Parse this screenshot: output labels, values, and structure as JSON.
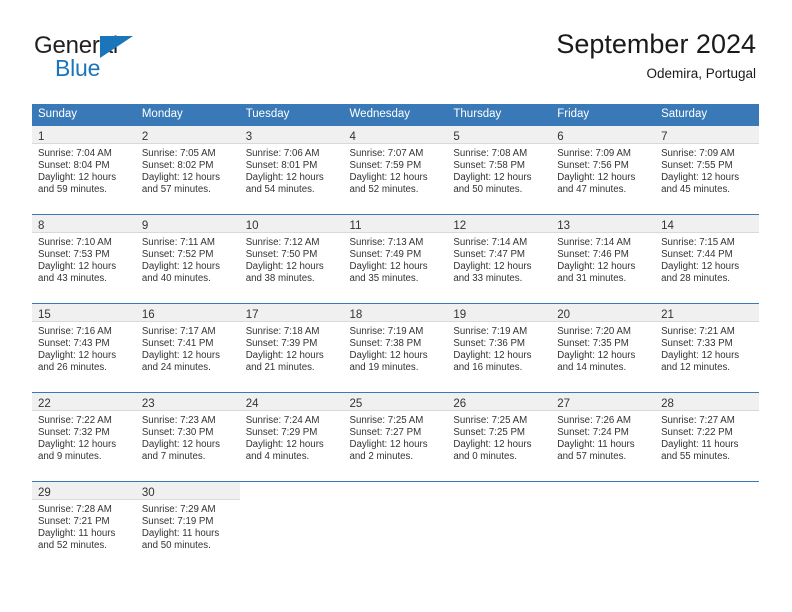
{
  "brand": {
    "name_part1": "General",
    "name_part2": "Blue",
    "accent_color": "#1b75bb"
  },
  "header": {
    "title": "September 2024",
    "subtitle": "Odemira, Portugal"
  },
  "theme": {
    "header_row_color": "#3a79b8",
    "daynum_band_color": "#f0f0f0",
    "text_color": "#333333"
  },
  "weekdays": [
    "Sunday",
    "Monday",
    "Tuesday",
    "Wednesday",
    "Thursday",
    "Friday",
    "Saturday"
  ],
  "weeks": [
    [
      {
        "day": "1",
        "lines": [
          "Sunrise: 7:04 AM",
          "Sunset: 8:04 PM",
          "Daylight: 12 hours",
          "and 59 minutes."
        ]
      },
      {
        "day": "2",
        "lines": [
          "Sunrise: 7:05 AM",
          "Sunset: 8:02 PM",
          "Daylight: 12 hours",
          "and 57 minutes."
        ]
      },
      {
        "day": "3",
        "lines": [
          "Sunrise: 7:06 AM",
          "Sunset: 8:01 PM",
          "Daylight: 12 hours",
          "and 54 minutes."
        ]
      },
      {
        "day": "4",
        "lines": [
          "Sunrise: 7:07 AM",
          "Sunset: 7:59 PM",
          "Daylight: 12 hours",
          "and 52 minutes."
        ]
      },
      {
        "day": "5",
        "lines": [
          "Sunrise: 7:08 AM",
          "Sunset: 7:58 PM",
          "Daylight: 12 hours",
          "and 50 minutes."
        ]
      },
      {
        "day": "6",
        "lines": [
          "Sunrise: 7:09 AM",
          "Sunset: 7:56 PM",
          "Daylight: 12 hours",
          "and 47 minutes."
        ]
      },
      {
        "day": "7",
        "lines": [
          "Sunrise: 7:09 AM",
          "Sunset: 7:55 PM",
          "Daylight: 12 hours",
          "and 45 minutes."
        ]
      }
    ],
    [
      {
        "day": "8",
        "lines": [
          "Sunrise: 7:10 AM",
          "Sunset: 7:53 PM",
          "Daylight: 12 hours",
          "and 43 minutes."
        ]
      },
      {
        "day": "9",
        "lines": [
          "Sunrise: 7:11 AM",
          "Sunset: 7:52 PM",
          "Daylight: 12 hours",
          "and 40 minutes."
        ]
      },
      {
        "day": "10",
        "lines": [
          "Sunrise: 7:12 AM",
          "Sunset: 7:50 PM",
          "Daylight: 12 hours",
          "and 38 minutes."
        ]
      },
      {
        "day": "11",
        "lines": [
          "Sunrise: 7:13 AM",
          "Sunset: 7:49 PM",
          "Daylight: 12 hours",
          "and 35 minutes."
        ]
      },
      {
        "day": "12",
        "lines": [
          "Sunrise: 7:14 AM",
          "Sunset: 7:47 PM",
          "Daylight: 12 hours",
          "and 33 minutes."
        ]
      },
      {
        "day": "13",
        "lines": [
          "Sunrise: 7:14 AM",
          "Sunset: 7:46 PM",
          "Daylight: 12 hours",
          "and 31 minutes."
        ]
      },
      {
        "day": "14",
        "lines": [
          "Sunrise: 7:15 AM",
          "Sunset: 7:44 PM",
          "Daylight: 12 hours",
          "and 28 minutes."
        ]
      }
    ],
    [
      {
        "day": "15",
        "lines": [
          "Sunrise: 7:16 AM",
          "Sunset: 7:43 PM",
          "Daylight: 12 hours",
          "and 26 minutes."
        ]
      },
      {
        "day": "16",
        "lines": [
          "Sunrise: 7:17 AM",
          "Sunset: 7:41 PM",
          "Daylight: 12 hours",
          "and 24 minutes."
        ]
      },
      {
        "day": "17",
        "lines": [
          "Sunrise: 7:18 AM",
          "Sunset: 7:39 PM",
          "Daylight: 12 hours",
          "and 21 minutes."
        ]
      },
      {
        "day": "18",
        "lines": [
          "Sunrise: 7:19 AM",
          "Sunset: 7:38 PM",
          "Daylight: 12 hours",
          "and 19 minutes."
        ]
      },
      {
        "day": "19",
        "lines": [
          "Sunrise: 7:19 AM",
          "Sunset: 7:36 PM",
          "Daylight: 12 hours",
          "and 16 minutes."
        ]
      },
      {
        "day": "20",
        "lines": [
          "Sunrise: 7:20 AM",
          "Sunset: 7:35 PM",
          "Daylight: 12 hours",
          "and 14 minutes."
        ]
      },
      {
        "day": "21",
        "lines": [
          "Sunrise: 7:21 AM",
          "Sunset: 7:33 PM",
          "Daylight: 12 hours",
          "and 12 minutes."
        ]
      }
    ],
    [
      {
        "day": "22",
        "lines": [
          "Sunrise: 7:22 AM",
          "Sunset: 7:32 PM",
          "Daylight: 12 hours",
          "and 9 minutes."
        ]
      },
      {
        "day": "23",
        "lines": [
          "Sunrise: 7:23 AM",
          "Sunset: 7:30 PM",
          "Daylight: 12 hours",
          "and 7 minutes."
        ]
      },
      {
        "day": "24",
        "lines": [
          "Sunrise: 7:24 AM",
          "Sunset: 7:29 PM",
          "Daylight: 12 hours",
          "and 4 minutes."
        ]
      },
      {
        "day": "25",
        "lines": [
          "Sunrise: 7:25 AM",
          "Sunset: 7:27 PM",
          "Daylight: 12 hours",
          "and 2 minutes."
        ]
      },
      {
        "day": "26",
        "lines": [
          "Sunrise: 7:25 AM",
          "Sunset: 7:25 PM",
          "Daylight: 12 hours",
          "and 0 minutes."
        ]
      },
      {
        "day": "27",
        "lines": [
          "Sunrise: 7:26 AM",
          "Sunset: 7:24 PM",
          "Daylight: 11 hours",
          "and 57 minutes."
        ]
      },
      {
        "day": "28",
        "lines": [
          "Sunrise: 7:27 AM",
          "Sunset: 7:22 PM",
          "Daylight: 11 hours",
          "and 55 minutes."
        ]
      }
    ],
    [
      {
        "day": "29",
        "lines": [
          "Sunrise: 7:28 AM",
          "Sunset: 7:21 PM",
          "Daylight: 11 hours",
          "and 52 minutes."
        ]
      },
      {
        "day": "30",
        "lines": [
          "Sunrise: 7:29 AM",
          "Sunset: 7:19 PM",
          "Daylight: 11 hours",
          "and 50 minutes."
        ]
      },
      {
        "day": "",
        "lines": []
      },
      {
        "day": "",
        "lines": []
      },
      {
        "day": "",
        "lines": []
      },
      {
        "day": "",
        "lines": []
      },
      {
        "day": "",
        "lines": []
      }
    ]
  ]
}
